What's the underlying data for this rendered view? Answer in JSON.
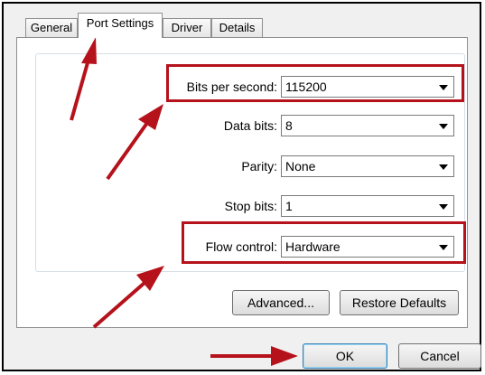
{
  "tabs": [
    {
      "label": "General"
    },
    {
      "label": "Port Settings"
    },
    {
      "label": "Driver"
    },
    {
      "label": "Details"
    }
  ],
  "fields": {
    "bits_per_second": {
      "label": "Bits per second:",
      "value": "115200"
    },
    "data_bits": {
      "label": "Data bits:",
      "value": "8"
    },
    "parity": {
      "label": "Parity:",
      "value": "None"
    },
    "stop_bits": {
      "label": "Stop bits:",
      "value": "1"
    },
    "flow_control": {
      "label": "Flow control:",
      "value": "Hardware"
    }
  },
  "buttons": {
    "advanced": "Advanced...",
    "restore_defaults": "Restore Defaults",
    "ok": "OK",
    "cancel": "Cancel"
  },
  "colors": {
    "annotation": "#b5121b",
    "highlight_border": "#b5121b"
  }
}
